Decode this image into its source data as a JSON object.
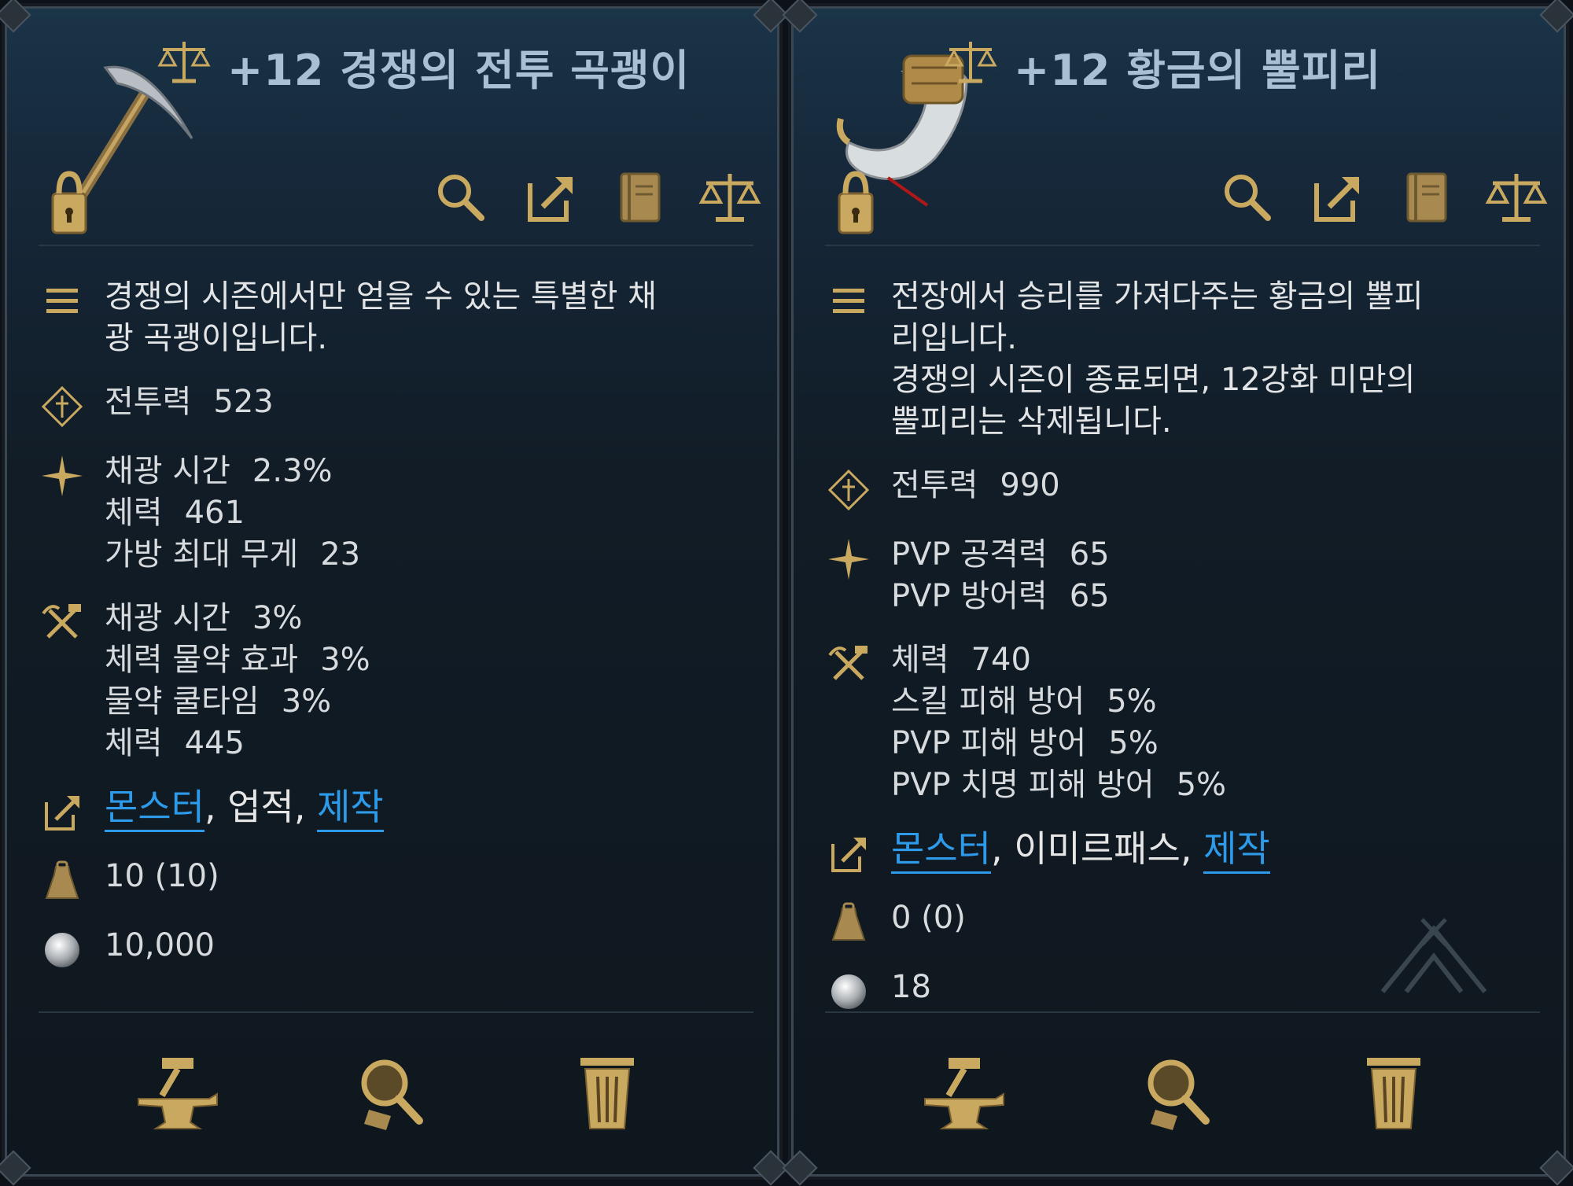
{
  "colors": {
    "gold": "#c9a860",
    "link": "#2e9bea",
    "title": "#a9bfd3",
    "text": "#d7dbde"
  },
  "left": {
    "title": "+12 경쟁의 전투 곡괭이",
    "item_icon": "pickaxe",
    "tools": [
      "search-icon",
      "link-out-icon",
      "book-icon",
      "scale-icon"
    ],
    "desc_lines": [
      "경쟁의 시즌에서만 얻을 수 있는 특별한 채",
      "광 곡괭이입니다."
    ],
    "power_label": "전투력",
    "power_value": "523",
    "stats_a": [
      {
        "label": "채광 시간",
        "value": "2.3%"
      },
      {
        "label": "체력",
        "value": "461"
      },
      {
        "label": "가방 최대 무게",
        "value": "23"
      }
    ],
    "stats_b": [
      {
        "label": "채광 시간",
        "value": "3%"
      },
      {
        "label": "체력 물약 효과",
        "value": "3%"
      },
      {
        "label": "물약 쿨타임",
        "value": "3%"
      },
      {
        "label": "체력",
        "value": "445"
      }
    ],
    "source": {
      "a": "몬스터",
      "sep1": ", ",
      "b": "업적",
      "sep2": ", ",
      "c": "제작"
    },
    "weight": "10 (10)",
    "price": "10,000"
  },
  "right": {
    "title": "+12 황금의 뿔피리",
    "item_icon": "golden-horn",
    "tools": [
      "search-icon",
      "link-out-icon",
      "book-icon",
      "scale-icon"
    ],
    "desc_lines": [
      "전장에서 승리를 가져다주는 황금의 뿔피",
      "리입니다.",
      "경쟁의 시즌이 종료되면, 12강화 미만의",
      "뿔피리는 삭제됩니다."
    ],
    "power_label": "전투력",
    "power_value": "990",
    "stats_a": [
      {
        "label": "PVP 공격력",
        "value": "65"
      },
      {
        "label": "PVP 방어력",
        "value": "65"
      }
    ],
    "stats_b": [
      {
        "label": "체력",
        "value": "740"
      },
      {
        "label": "스킬 피해 방어",
        "value": "5%"
      },
      {
        "label": "PVP 피해 방어",
        "value": "5%"
      },
      {
        "label": "PVP 치명 피해 방어",
        "value": "5%"
      }
    ],
    "source": {
      "a": "몬스터",
      "sep1": ", ",
      "b": "이미르패스",
      "sep2": ", ",
      "c": "제작"
    },
    "weight": "0 (0)",
    "price": "18"
  },
  "bottom_buttons": [
    "anvil-icon",
    "appraise-icon",
    "trash-icon"
  ]
}
